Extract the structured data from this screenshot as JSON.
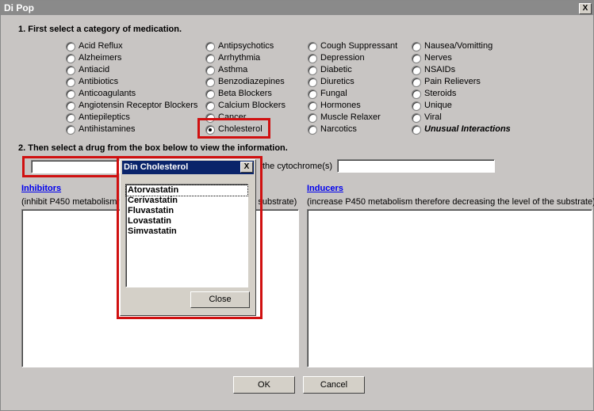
{
  "window": {
    "title": "Di Pop",
    "close": "X"
  },
  "step1": "1. First select a category of medication.",
  "categories": [
    [
      "Acid Reflux",
      "Alzheimers",
      "Antiacid",
      "Antibiotics",
      "Anticoagulants",
      "Angiotensin Receptor Blockers",
      "Antiepileptics",
      "Antihistamines"
    ],
    [
      "Antipsychotics",
      "Arrhythmia",
      "Asthma",
      "Benzodiazepines",
      "Beta Blockers",
      "Calcium Blockers",
      "Cancer",
      "Cholesterol"
    ],
    [
      "Cough Suppressant",
      "Depression",
      "Diabetic",
      "Diuretics",
      "Fungal",
      "Hormones",
      "Muscle Relaxer",
      "Narcotics"
    ],
    [
      "Nausea/Vomitting",
      "Nerves",
      "NSAIDs",
      "Pain Relievers",
      "Steroids",
      "Unique",
      "Viral",
      "Unusual Interactions"
    ]
  ],
  "selected_category": "Cholesterol",
  "step2": "2. Then select a drug from the box below to view the information.",
  "drug_value": "",
  "cytochrome_label": "the cytochrome(s)",
  "cytochrome_value": "",
  "inhibitors": {
    "label": "Inhibitors",
    "desc": "(inhibit P450 metabolism therefore increasing the level of the substrate)"
  },
  "inducers": {
    "label": "Inducers",
    "desc": "(increase P450 metabolism therefore decreasing the level of the substrate)"
  },
  "popup": {
    "title": "Din Cholesterol",
    "close_x": "X",
    "items": [
      "Atorvastatin",
      "Cerivastatin",
      "Fluvastatin",
      "Lovastatin",
      "Simvastatin"
    ],
    "close": "Close"
  },
  "buttons": {
    "ok": "OK",
    "cancel": "Cancel"
  },
  "colors": {
    "highlight": "#d01010",
    "popup_title": "#0a246a",
    "link": "#0000ee"
  }
}
